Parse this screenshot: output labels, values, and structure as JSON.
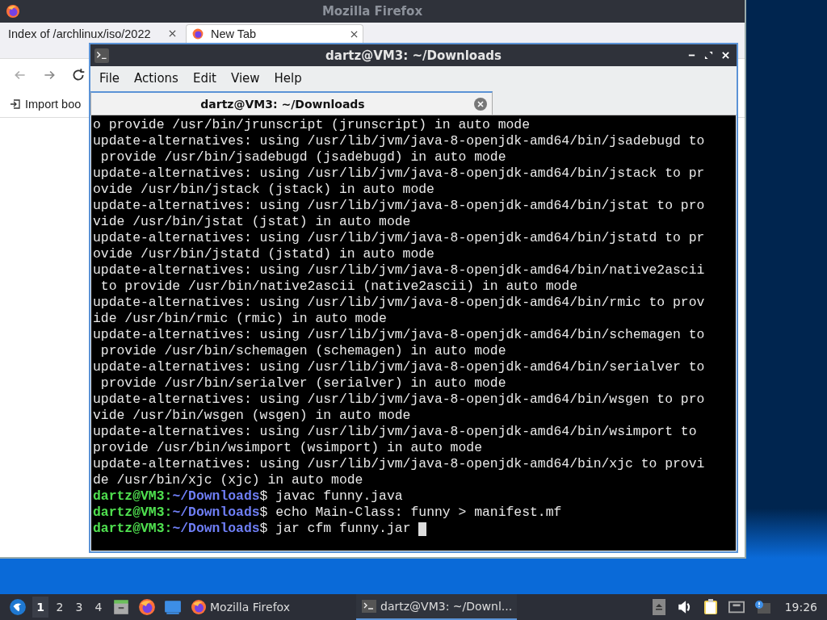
{
  "firefox": {
    "title": "Mozilla Firefox",
    "tabs": [
      {
        "label": "Index of /archlinux/iso/2022",
        "selected": false
      },
      {
        "label": "New Tab",
        "selected": true
      }
    ],
    "bookmarks": [
      "Import boo"
    ]
  },
  "terminal": {
    "title": "dartz@VM3: ~/Downloads",
    "menu": [
      "File",
      "Actions",
      "Edit",
      "View",
      "Help"
    ],
    "tabs": [
      {
        "label": "dartz@VM3: ~/Downloads",
        "selected": true
      }
    ],
    "output": [
      "o provide /usr/bin/jrunscript (jrunscript) in auto mode",
      "update-alternatives: using /usr/lib/jvm/java-8-openjdk-amd64/bin/jsadebugd to",
      " provide /usr/bin/jsadebugd (jsadebugd) in auto mode",
      "update-alternatives: using /usr/lib/jvm/java-8-openjdk-amd64/bin/jstack to pr",
      "ovide /usr/bin/jstack (jstack) in auto mode",
      "update-alternatives: using /usr/lib/jvm/java-8-openjdk-amd64/bin/jstat to pro",
      "vide /usr/bin/jstat (jstat) in auto mode",
      "update-alternatives: using /usr/lib/jvm/java-8-openjdk-amd64/bin/jstatd to pr",
      "ovide /usr/bin/jstatd (jstatd) in auto mode",
      "update-alternatives: using /usr/lib/jvm/java-8-openjdk-amd64/bin/native2ascii",
      " to provide /usr/bin/native2ascii (native2ascii) in auto mode",
      "update-alternatives: using /usr/lib/jvm/java-8-openjdk-amd64/bin/rmic to prov",
      "ide /usr/bin/rmic (rmic) in auto mode",
      "update-alternatives: using /usr/lib/jvm/java-8-openjdk-amd64/bin/schemagen to",
      " provide /usr/bin/schemagen (schemagen) in auto mode",
      "update-alternatives: using /usr/lib/jvm/java-8-openjdk-amd64/bin/serialver to",
      " provide /usr/bin/serialver (serialver) in auto mode",
      "update-alternatives: using /usr/lib/jvm/java-8-openjdk-amd64/bin/wsgen to pro",
      "vide /usr/bin/wsgen (wsgen) in auto mode",
      "update-alternatives: using /usr/lib/jvm/java-8-openjdk-amd64/bin/wsimport to",
      "provide /usr/bin/wsimport (wsimport) in auto mode",
      "update-alternatives: using /usr/lib/jvm/java-8-openjdk-amd64/bin/xjc to provi",
      "de /usr/bin/xjc (xjc) in auto mode"
    ],
    "prompts": [
      {
        "user": "dartz@VM3:",
        "path": "~/Downloads",
        "command": "$ javac funny.java"
      },
      {
        "user": "dartz@VM3:",
        "path": "~/Downloads",
        "command": "$ echo Main-Class: funny > manifest.mf"
      },
      {
        "user": "dartz@VM3:",
        "path": "~/Downloads",
        "command": "$ jar cfm funny.jar "
      }
    ]
  },
  "taskbar": {
    "workspaces": [
      {
        "label": "1",
        "selected": true
      },
      {
        "label": "2",
        "selected": false
      },
      {
        "label": "3",
        "selected": false
      },
      {
        "label": "4",
        "selected": false
      }
    ],
    "tasks": [
      {
        "label": "Mozilla Firefox",
        "kind": "browser",
        "selected": false
      },
      {
        "label": "dartz@VM3: ~/Downl...",
        "kind": "terminal",
        "selected": true
      }
    ],
    "clock": "19:26"
  }
}
